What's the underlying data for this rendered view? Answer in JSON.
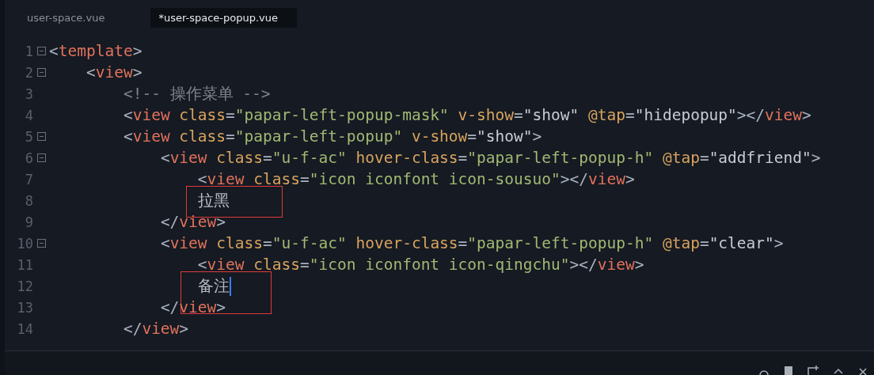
{
  "tabs": [
    {
      "label": "user-space.vue",
      "selected": false
    },
    {
      "label": "*user-space-popup.vue",
      "selected": true
    }
  ],
  "lines": [
    {
      "number": "1",
      "fold": true,
      "tokens": [
        {
          "kind": "punct",
          "text": "<"
        },
        {
          "kind": "tag",
          "text": "template"
        },
        {
          "kind": "punct",
          "text": ">"
        }
      ],
      "children": [
        {
          "number": "2",
          "fold": true,
          "tokens": [
            {
              "kind": "punct",
              "text": "<"
            },
            {
              "kind": "tag",
              "text": "view"
            },
            {
              "kind": "punct",
              "text": ">"
            }
          ],
          "children": [
            {
              "number": "3",
              "fold": false,
              "tokens": [
                {
                  "kind": "comment",
                  "text": "<!-- 操作菜单 -->"
                }
              ]
            },
            {
              "number": "4",
              "fold": false,
              "tokens": [
                {
                  "kind": "punct",
                  "text": "<"
                },
                {
                  "kind": "tag",
                  "text": "view"
                },
                {
                  "kind": "attr",
                  "text": " class"
                },
                {
                  "kind": "punct",
                  "text": "="
                },
                {
                  "kind": "string",
                  "text": "\"papar-left-popup-mask\""
                },
                {
                  "kind": "attr",
                  "text": " v-show"
                },
                {
                  "kind": "punct",
                  "text": "="
                },
                {
                  "kind": "value",
                  "text": "\"show\""
                },
                {
                  "kind": "attr",
                  "text": " @tap"
                },
                {
                  "kind": "punct",
                  "text": "="
                },
                {
                  "kind": "value",
                  "text": "\"hidepopup\""
                },
                {
                  "kind": "punct",
                  "text": "></"
                },
                {
                  "kind": "tag",
                  "text": "view"
                },
                {
                  "kind": "punct",
                  "text": ">"
                }
              ]
            },
            {
              "number": "5",
              "fold": true,
              "tokens": [
                {
                  "kind": "punct",
                  "text": "<"
                },
                {
                  "kind": "tag",
                  "text": "view"
                },
                {
                  "kind": "attr",
                  "text": " class"
                },
                {
                  "kind": "punct",
                  "text": "="
                },
                {
                  "kind": "string",
                  "text": "\"papar-left-popup\""
                },
                {
                  "kind": "attr",
                  "text": " v-show"
                },
                {
                  "kind": "punct",
                  "text": "="
                },
                {
                  "kind": "value",
                  "text": "\"show\""
                },
                {
                  "kind": "punct",
                  "text": ">"
                }
              ],
              "children": [
                {
                  "number": "6",
                  "fold": true,
                  "tokens": [
                    {
                      "kind": "punct",
                      "text": "<"
                    },
                    {
                      "kind": "tag",
                      "text": "view"
                    },
                    {
                      "kind": "attr",
                      "text": " class"
                    },
                    {
                      "kind": "punct",
                      "text": "="
                    },
                    {
                      "kind": "string",
                      "text": "\"u-f-ac\""
                    },
                    {
                      "kind": "attr",
                      "text": " hover-class"
                    },
                    {
                      "kind": "punct",
                      "text": "="
                    },
                    {
                      "kind": "string",
                      "text": "\"papar-left-popup-h\""
                    },
                    {
                      "kind": "attr",
                      "text": " @tap"
                    },
                    {
                      "kind": "punct",
                      "text": "="
                    },
                    {
                      "kind": "value",
                      "text": "\"addfriend\""
                    },
                    {
                      "kind": "punct",
                      "text": ">"
                    }
                  ],
                  "children": [
                    {
                      "number": "7",
                      "fold": false,
                      "tokens": [
                        {
                          "kind": "punct",
                          "text": "<"
                        },
                        {
                          "kind": "tag",
                          "text": "view"
                        },
                        {
                          "kind": "attr",
                          "text": " class"
                        },
                        {
                          "kind": "punct",
                          "text": "="
                        },
                        {
                          "kind": "string",
                          "text": "\"icon iconfont icon-sousuo\""
                        },
                        {
                          "kind": "punct",
                          "text": "></"
                        },
                        {
                          "kind": "tag",
                          "text": "view"
                        },
                        {
                          "kind": "punct",
                          "text": ">"
                        }
                      ]
                    },
                    {
                      "number": "8",
                      "fold": false,
                      "annotated": true,
                      "cursor": false,
                      "tokens": [
                        {
                          "kind": "text",
                          "text": "拉黑"
                        }
                      ]
                    }
                  ]
                },
                {
                  "number": "9",
                  "fold": false,
                  "tokens": [
                    {
                      "kind": "punct",
                      "text": "</"
                    },
                    {
                      "kind": "tag",
                      "text": "view"
                    },
                    {
                      "kind": "punct",
                      "text": ">"
                    }
                  ]
                },
                {
                  "number": "10",
                  "fold": true,
                  "tokens": [
                    {
                      "kind": "punct",
                      "text": "<"
                    },
                    {
                      "kind": "tag",
                      "text": "view"
                    },
                    {
                      "kind": "attr",
                      "text": " class"
                    },
                    {
                      "kind": "punct",
                      "text": "="
                    },
                    {
                      "kind": "string",
                      "text": "\"u-f-ac\""
                    },
                    {
                      "kind": "attr",
                      "text": " hover-class"
                    },
                    {
                      "kind": "punct",
                      "text": "="
                    },
                    {
                      "kind": "string",
                      "text": "\"papar-left-popup-h\""
                    },
                    {
                      "kind": "attr",
                      "text": " @tap"
                    },
                    {
                      "kind": "punct",
                      "text": "="
                    },
                    {
                      "kind": "value",
                      "text": "\"clear\""
                    },
                    {
                      "kind": "punct",
                      "text": ">"
                    }
                  ],
                  "children": [
                    {
                      "number": "11",
                      "fold": false,
                      "tokens": [
                        {
                          "kind": "punct",
                          "text": "<"
                        },
                        {
                          "kind": "tag",
                          "text": "view"
                        },
                        {
                          "kind": "attr",
                          "text": " class"
                        },
                        {
                          "kind": "punct",
                          "text": "="
                        },
                        {
                          "kind": "string",
                          "text": "\"icon iconfont icon-qingchu\""
                        },
                        {
                          "kind": "punct",
                          "text": "></"
                        },
                        {
                          "kind": "tag",
                          "text": "view"
                        },
                        {
                          "kind": "punct",
                          "text": ">"
                        }
                      ]
                    },
                    {
                      "number": "12",
                      "fold": false,
                      "annotated": true,
                      "cursor": true,
                      "tokens": [
                        {
                          "kind": "text",
                          "text": "备注"
                        }
                      ]
                    }
                  ]
                },
                {
                  "number": "13",
                  "fold": false,
                  "tokens": [
                    {
                      "kind": "punct",
                      "text": "</"
                    },
                    {
                      "kind": "tag",
                      "text": "view"
                    },
                    {
                      "kind": "punct",
                      "text": ">"
                    }
                  ]
                }
              ]
            },
            {
              "number": "14",
              "fold": false,
              "tokens": [
                {
                  "kind": "punct",
                  "text": "</"
                },
                {
                  "kind": "tag",
                  "text": "view"
                },
                {
                  "kind": "punct",
                  "text": ">"
                }
              ]
            }
          ]
        }
      ]
    }
  ]
}
